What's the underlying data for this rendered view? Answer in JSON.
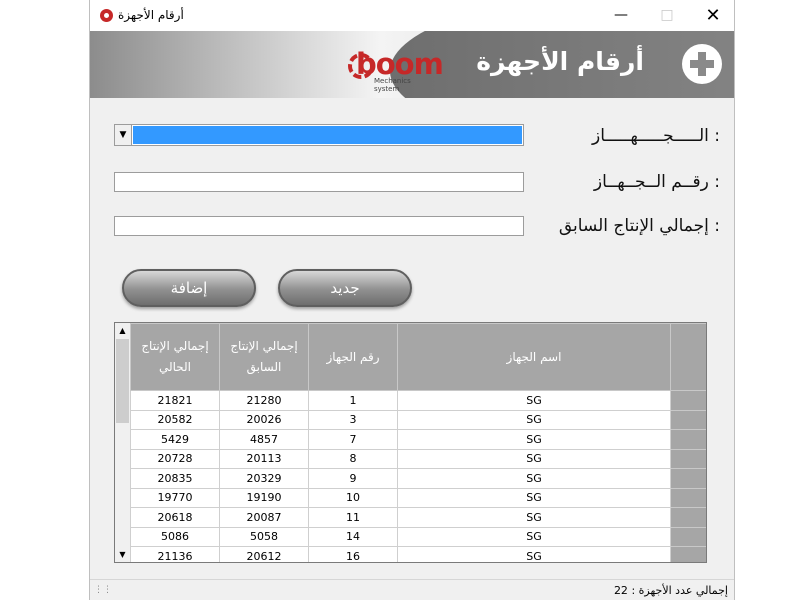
{
  "window": {
    "title": "أرقام الأجهزة",
    "icon": "app-logo-icon",
    "controls": [
      "minimize-icon",
      "maximize-icon",
      "close-icon"
    ]
  },
  "banner": {
    "title": "أرقام الأجهزة",
    "logo_text": "boom",
    "logo_subtext": "Mechanics system",
    "icon": "plus-circle-icon"
  },
  "form": {
    "device_label": ":   الـــــجـــــهـــــاز",
    "device_number_label": ":   رقــم  الــجــهــاز",
    "prev_total_label": ":  إجمالي الإنتاج السابق",
    "device_value": "",
    "device_number_value": "",
    "prev_total_value": ""
  },
  "buttons": {
    "new_label": "جديد",
    "add_label": "إضافة"
  },
  "table": {
    "headers": {
      "current_total": "إجمالي الإنتاج الحالي",
      "previous_total": "إجمالي الإنتاج السابق",
      "device_number": "رقم الجهاز",
      "device_name": "اسم الجهاز"
    },
    "rows": [
      {
        "current": "21821",
        "previous": "21280",
        "number": "1",
        "name": "SG"
      },
      {
        "current": "20582",
        "previous": "20026",
        "number": "3",
        "name": "SG"
      },
      {
        "current": "5429",
        "previous": "4857",
        "number": "7",
        "name": "SG"
      },
      {
        "current": "20728",
        "previous": "20113",
        "number": "8",
        "name": "SG"
      },
      {
        "current": "20835",
        "previous": "20329",
        "number": "9",
        "name": "SG"
      },
      {
        "current": "19770",
        "previous": "19190",
        "number": "10",
        "name": "SG"
      },
      {
        "current": "20618",
        "previous": "20087",
        "number": "11",
        "name": "SG"
      },
      {
        "current": "5086",
        "previous": "5058",
        "number": "14",
        "name": "SG"
      },
      {
        "current": "21136",
        "previous": "20612",
        "number": "16",
        "name": "SG"
      }
    ]
  },
  "status": {
    "total_devices_label": "إجمالي عدد الأجهزة :",
    "total_devices_value": "22"
  },
  "colors": {
    "accent_red": "#c62828",
    "selection_blue": "#3399ff",
    "header_gray": "#a6a6a6"
  }
}
